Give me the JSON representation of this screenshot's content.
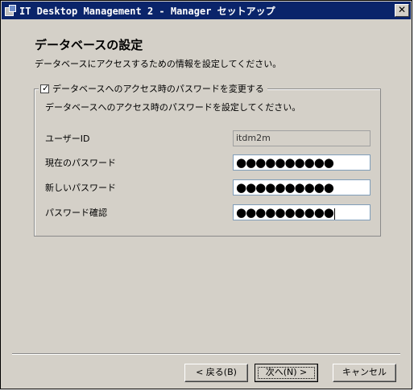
{
  "window": {
    "title": "IT Desktop Management 2 - Manager セットアップ",
    "close_label": "✕"
  },
  "header": {
    "title": "データベースの設定",
    "description": "データベースにアクセスするための情報を設定してください。"
  },
  "group": {
    "checkbox_label": "データベースへのアクセス時のパスワードを変更する",
    "checkbox_checked": true,
    "hint": "データベースへのアクセス時のパスワードを設定してください。"
  },
  "fields": {
    "user_id": {
      "label": "ユーザーID",
      "value": "itdm2m"
    },
    "current_password": {
      "label": "現在のパスワード",
      "value": "●●●●●●●●●●"
    },
    "new_password": {
      "label": "新しいパスワード",
      "value": "●●●●●●●●●●"
    },
    "confirm_password": {
      "label": "パスワード確認",
      "value": "●●●●●●●●●●"
    }
  },
  "buttons": {
    "back": "< 戻る(B)",
    "next": "次へ(N) >",
    "cancel": "キャンセル"
  }
}
